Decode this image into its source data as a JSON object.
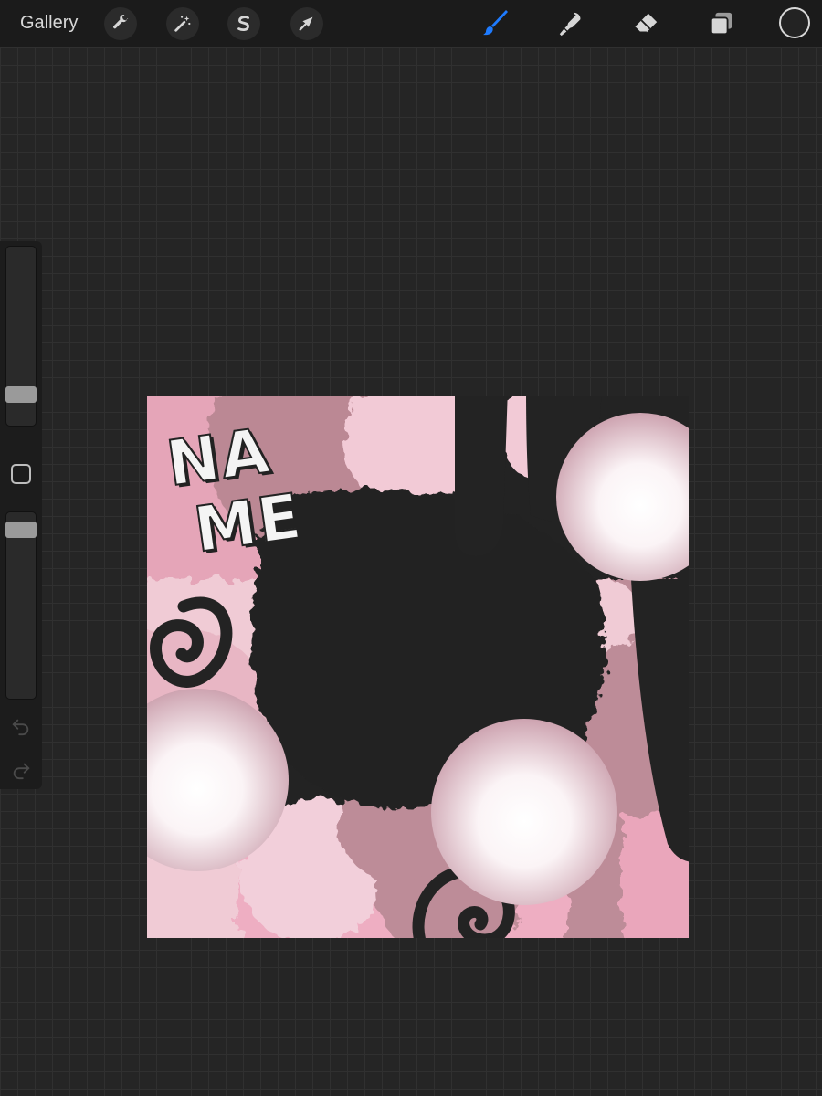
{
  "toolbar": {
    "gallery_label": "Gallery",
    "left_tools": [
      "wrench-icon",
      "magic-wand-icon",
      "selection-icon",
      "transform-arrow-icon"
    ],
    "right_tools": [
      "brush-icon",
      "smudge-icon",
      "eraser-icon",
      "layers-icon"
    ],
    "active_tool": "brush",
    "accent_color": "#1e7bff",
    "current_color": "#232323"
  },
  "sidebar": {
    "brush_size_level": 0.82,
    "opacity_level": 0.95,
    "undo_icon": "undo-arrow-icon",
    "redo_icon": "redo-arrow-icon"
  },
  "canvas": {
    "artwork_text_line1": "NA",
    "artwork_text_line2": "ME",
    "palette": {
      "pink": "#e8a8bd",
      "light_pink": "#f1cdd8",
      "mauve": "#bd8c98",
      "dark": "#232323",
      "pearl": "#f6eef1"
    }
  }
}
